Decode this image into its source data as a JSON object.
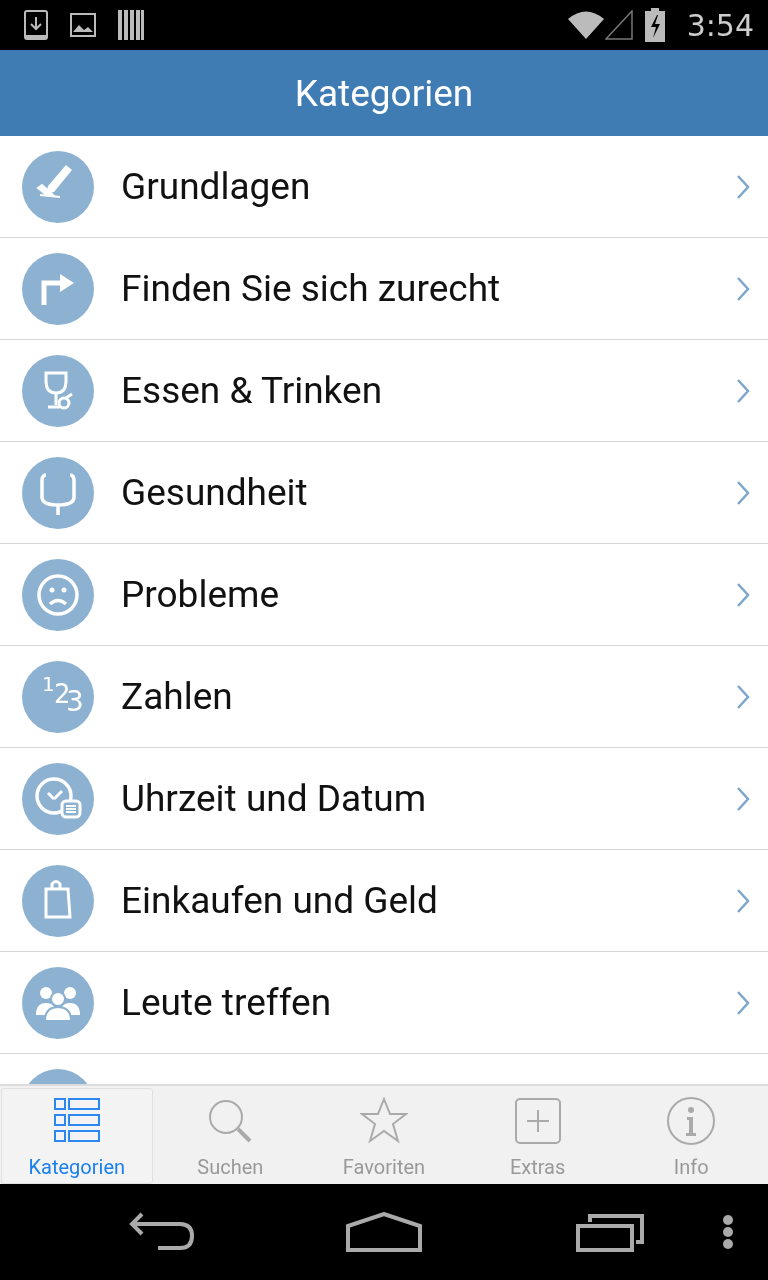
{
  "status_bar": {
    "time": "3:54"
  },
  "header": {
    "title": "Kategorien"
  },
  "categories": [
    {
      "kind": "row",
      "label": "Grundlagen"
    },
    {
      "kind": "row",
      "label": "Finden Sie sich zurecht"
    },
    {
      "kind": "row",
      "label": "Essen & Trinken"
    },
    {
      "kind": "row",
      "label": "Gesundheit"
    },
    {
      "kind": "row",
      "label": "Probleme"
    },
    {
      "kind": "row",
      "label": "Zahlen",
      "icon_text": "123"
    },
    {
      "kind": "row",
      "label": "Uhrzeit und Datum"
    },
    {
      "kind": "row",
      "label": "Einkaufen und Geld"
    },
    {
      "kind": "row",
      "label": "Leute treffen"
    },
    {
      "kind": "partial"
    }
  ],
  "tabs": [
    {
      "label": "Kategorien",
      "selected": true
    },
    {
      "label": "Suchen",
      "selected": false
    },
    {
      "label": "Favoriten",
      "selected": false
    },
    {
      "label": "Extras",
      "selected": false
    },
    {
      "label": "Info",
      "selected": false
    }
  ]
}
